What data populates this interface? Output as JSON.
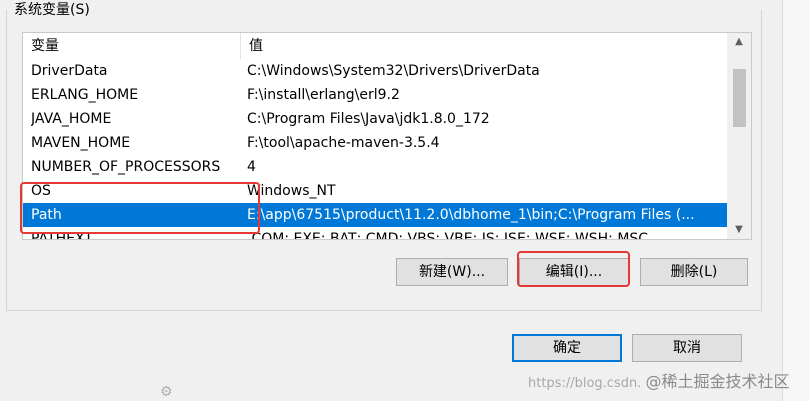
{
  "group": {
    "legend": "系统变量(S)"
  },
  "table": {
    "columns": [
      "变量",
      "值"
    ],
    "rows": [
      {
        "name": "DriverData",
        "value": "C:\\Windows\\System32\\Drivers\\DriverData"
      },
      {
        "name": "ERLANG_HOME",
        "value": "F:\\install\\erlang\\erl9.2"
      },
      {
        "name": "JAVA_HOME",
        "value": "C:\\Program Files\\Java\\jdk1.8.0_172"
      },
      {
        "name": "MAVEN_HOME",
        "value": "F:\\tool\\apache-maven-3.5.4"
      },
      {
        "name": "NUMBER_OF_PROCESSORS",
        "value": "4"
      },
      {
        "name": "OS",
        "value": "Windows_NT"
      },
      {
        "name": "Path",
        "value": "E:\\app\\67515\\product\\11.2.0\\dbhome_1\\bin;C:\\Program Files (..."
      },
      {
        "name": "PATHEXT",
        "value": ".COM;.EXE;.BAT;.CMD;.VBS;.VBE;.JS;.JSE;.WSF;.WSH;.MSC"
      }
    ],
    "selected_index": 6
  },
  "buttons": {
    "new": "新建(W)...",
    "edit": "编辑(I)...",
    "delete": "删除(L)",
    "ok": "确定",
    "cancel": "取消"
  },
  "watermark": {
    "url": "https://blog.csdn.",
    "brand": "@稀土掘金技术社区"
  },
  "colors": {
    "selection": "#0078d7",
    "annotation": "#e53935"
  }
}
